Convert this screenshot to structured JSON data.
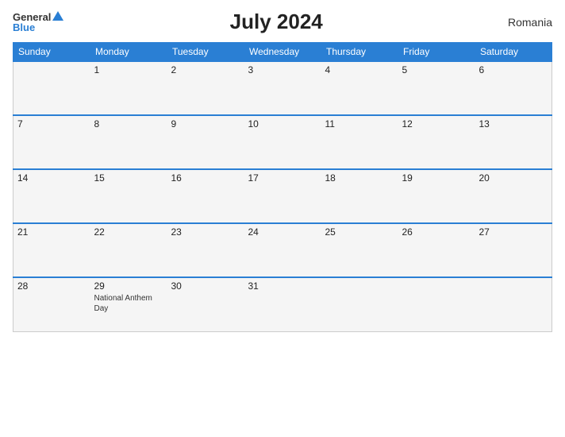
{
  "header": {
    "title": "July 2024",
    "country": "Romania",
    "logo": {
      "general": "General",
      "blue": "Blue"
    }
  },
  "weekdays": [
    "Sunday",
    "Monday",
    "Tuesday",
    "Wednesday",
    "Thursday",
    "Friday",
    "Saturday"
  ],
  "weeks": [
    [
      {
        "day": "",
        "events": []
      },
      {
        "day": "1",
        "events": []
      },
      {
        "day": "2",
        "events": []
      },
      {
        "day": "3",
        "events": []
      },
      {
        "day": "4",
        "events": []
      },
      {
        "day": "5",
        "events": []
      },
      {
        "day": "6",
        "events": []
      }
    ],
    [
      {
        "day": "7",
        "events": []
      },
      {
        "day": "8",
        "events": []
      },
      {
        "day": "9",
        "events": []
      },
      {
        "day": "10",
        "events": []
      },
      {
        "day": "11",
        "events": []
      },
      {
        "day": "12",
        "events": []
      },
      {
        "day": "13",
        "events": []
      }
    ],
    [
      {
        "day": "14",
        "events": []
      },
      {
        "day": "15",
        "events": []
      },
      {
        "day": "16",
        "events": []
      },
      {
        "day": "17",
        "events": []
      },
      {
        "day": "18",
        "events": []
      },
      {
        "day": "19",
        "events": []
      },
      {
        "day": "20",
        "events": []
      }
    ],
    [
      {
        "day": "21",
        "events": []
      },
      {
        "day": "22",
        "events": []
      },
      {
        "day": "23",
        "events": []
      },
      {
        "day": "24",
        "events": []
      },
      {
        "day": "25",
        "events": []
      },
      {
        "day": "26",
        "events": []
      },
      {
        "day": "27",
        "events": []
      }
    ],
    [
      {
        "day": "28",
        "events": []
      },
      {
        "day": "29",
        "events": [
          "National Anthem Day"
        ]
      },
      {
        "day": "30",
        "events": []
      },
      {
        "day": "31",
        "events": []
      },
      {
        "day": "",
        "events": []
      },
      {
        "day": "",
        "events": []
      },
      {
        "day": "",
        "events": []
      }
    ]
  ]
}
